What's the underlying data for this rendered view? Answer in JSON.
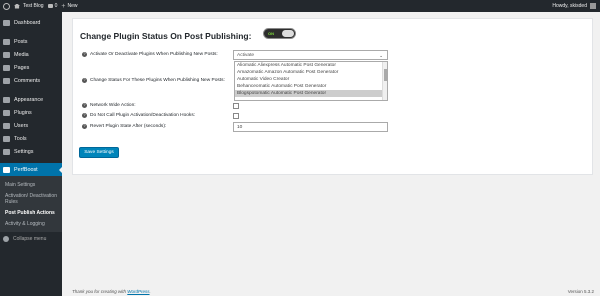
{
  "adminbar": {
    "site_name": "Test Blog",
    "comments_count": "0",
    "new_label": "New",
    "howdy": "Howdy, skisded"
  },
  "sidebar": {
    "items": [
      {
        "label": "Dashboard",
        "icon": "dashboard-icon"
      },
      {
        "label": "Posts",
        "icon": "pin-icon"
      },
      {
        "label": "Media",
        "icon": "media-icon"
      },
      {
        "label": "Pages",
        "icon": "page-icon"
      },
      {
        "label": "Comments",
        "icon": "comment-icon"
      },
      {
        "label": "Appearance",
        "icon": "brush-icon"
      },
      {
        "label": "Plugins",
        "icon": "plugin-icon"
      },
      {
        "label": "Users",
        "icon": "user-icon"
      },
      {
        "label": "Tools",
        "icon": "wrench-icon"
      },
      {
        "label": "Settings",
        "icon": "settings-icon"
      }
    ],
    "current": {
      "label": "PerfBoost",
      "icon": "perfboost-icon"
    },
    "submenu": [
      "Main Settings",
      "Activation/ Deactivation Rules",
      "Post Publish Actions",
      "Activity & Logging"
    ],
    "collapse_label": "Collapse menu"
  },
  "page": {
    "title": "Change Plugin Status On Post Publishing:",
    "toggle_label": "ON"
  },
  "form": {
    "activate_label": "Activate Or Deactivate Plugins When Publishing New Posts:",
    "activate_value": "Activate",
    "change_status_label": "Change Status For These Plugins When Publishing New Posts:",
    "plugin_options": [
      "Aliomatic Aliexpress Automatic Post Generator",
      "Amazomatic Amazon Automatic Post Generator",
      "Automatic Video Creator",
      "Behanceomatic Automatic Post Generator",
      "Blogspotomatic Automatic Post Generator"
    ],
    "selected_option_index": 4,
    "network_wide_label": "Network Wide Action:",
    "no_hooks_label": "Do Not Call Plugin Activation/Deactivation Hooks:",
    "revert_label": "Revert Plugin State After (seconds):",
    "revert_value": "10",
    "save_label": "Save Settings"
  },
  "footer": {
    "thanks_prefix": "Thank you for creating with ",
    "wordpress_link": "WordPress",
    "version": "Version 5.3.2"
  },
  "colors": {
    "accent": "#0073aa",
    "admin_bg": "#23282d",
    "button": "#0085ba"
  }
}
